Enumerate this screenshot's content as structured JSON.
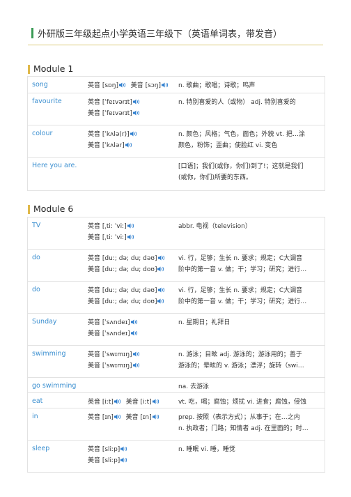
{
  "title": "外研版三年级起点小学英语三年级下（英语单词表，带发音）",
  "sections": [
    {
      "heading": "Module 1",
      "rows": [
        {
          "word": "song",
          "lines": [
            [
              "英音 [sɒŋ]",
              "美音 [sɔŋ]"
            ]
          ],
          "meaning": [
            "n. 歌曲；歌唱；诗歌；鸣声"
          ]
        },
        {
          "word": "favourite",
          "lines": [
            [
              "英音 [ˈfeɪvərɪt]"
            ],
            [
              "美音 [ˈfeɪvərɪt]"
            ]
          ],
          "meaning": [
            "n. 特别喜爱的人（或物） adj. 特别喜爱的"
          ]
        },
        {
          "word": "colour",
          "lines": [
            [
              "英音 [ˈkʌlə(r)]"
            ],
            [
              "美音 [ˈkʌlər]"
            ]
          ],
          "meaning": [
            "n. 颜色；风格；气色，面色；外貌 vt. 把…涂",
            "颜色，粉饰；歪曲；使脸红 vi. 变色"
          ]
        },
        {
          "word": "Here you are.",
          "lines": [],
          "meaning": [
            "[口语]；我们(或你，你们)到了!；这就是我们",
            "(或你，你们)所要的东西。"
          ]
        }
      ]
    },
    {
      "heading": "Module 6",
      "rows": [
        {
          "word": "TV",
          "lines": [
            [
              "英音 [ˌtiː ˈviː]"
            ],
            [
              "美音 [ˌtiː ˈviː]"
            ]
          ],
          "meaning": [
            "abbr. 电视（television）"
          ]
        },
        {
          "word": "do",
          "lines": [
            [
              "英音 [duː; də; du; dəʊ]"
            ],
            [
              "美音 [duː; də; du; doʊ]"
            ]
          ],
          "meaning": [
            "vi. 行，足够；生长 n. 要求；规定；C大调音",
            "阶中的第一音 v. 做；干；学习；研究；进行…"
          ]
        },
        {
          "word": "do",
          "lines": [
            [
              "英音 [duː; də; du; dəʊ]"
            ],
            [
              "美音 [duː; də; du; doʊ]"
            ]
          ],
          "meaning": [
            "vi. 行，足够；生长 n. 要求；规定；C大调音",
            "阶中的第一音 v. 做；干；学习；研究；进行…"
          ]
        },
        {
          "word": "Sunday",
          "lines": [
            [
              "英音 [ˈsʌndeɪ]"
            ],
            [
              "美音 [ˈsʌndeɪ]"
            ]
          ],
          "meaning": [
            "n. 星期日；礼拜日"
          ]
        },
        {
          "word": "swimming",
          "lines": [
            [
              "英音 [ˈswɪmɪŋ]"
            ],
            [
              "美音 [ˈswɪmɪŋ]"
            ]
          ],
          "meaning": [
            "n. 游泳；目眩 adj. 游泳的；游泳用的；善于",
            "游泳的；晕眩的 v. 游泳；漂浮；旋转（swi…"
          ]
        },
        {
          "word": "go swimming",
          "lines": [],
          "meaning": [
            "na. 去游泳"
          ]
        },
        {
          "word": "eat",
          "lines": [
            [
              "英音 [iːt]",
              "美音 [iːt]"
            ]
          ],
          "meaning": [
            "vt. 吃，喝；腐蚀；烦扰 vi. 进食；腐蚀，侵蚀"
          ]
        },
        {
          "word": "in",
          "lines": [
            [
              "英音 [ɪn]",
              "美音 [ɪn]"
            ]
          ],
          "meaning": [
            "prep. 按照（表示方式）；从事于；在…之内",
            "n. 执政者；门路；知情者 adj. 在里面的；时…"
          ]
        },
        {
          "word": "sleep",
          "lines": [
            [
              "英音 [sliːp]"
            ],
            [
              "美音 [sliːp]"
            ]
          ],
          "meaning": [
            "n. 睡眠 vi. 睡，睡觉"
          ]
        }
      ]
    }
  ]
}
